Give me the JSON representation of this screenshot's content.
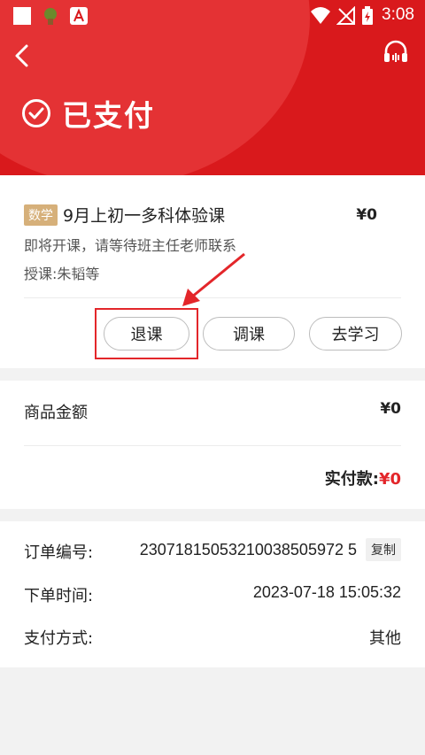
{
  "status_bar": {
    "time": "3:08"
  },
  "header": {
    "status_title": "已支付",
    "colors": {
      "accent": "#d9191c"
    }
  },
  "course": {
    "subject_badge": "数学",
    "title": "9月上初一多科体验课",
    "price": "¥0",
    "hint": "即将开课，请等待班主任老师联系",
    "teacher": "授课:朱韬等",
    "buttons": {
      "withdraw": "退课",
      "adjust": "调课",
      "study": "去学习"
    }
  },
  "summary": {
    "amount_label": "商品金额",
    "amount_value": "¥0",
    "paid_label": "实付款:",
    "paid_value": "¥0"
  },
  "order": {
    "number_label": "订单编号:",
    "number_value": "23071815053210038505972 5",
    "copy_label": "复制",
    "time_label": "下单时间:",
    "time_value": "2023-07-18 15:05:32",
    "method_label": "支付方式:",
    "method_value": "其他"
  }
}
